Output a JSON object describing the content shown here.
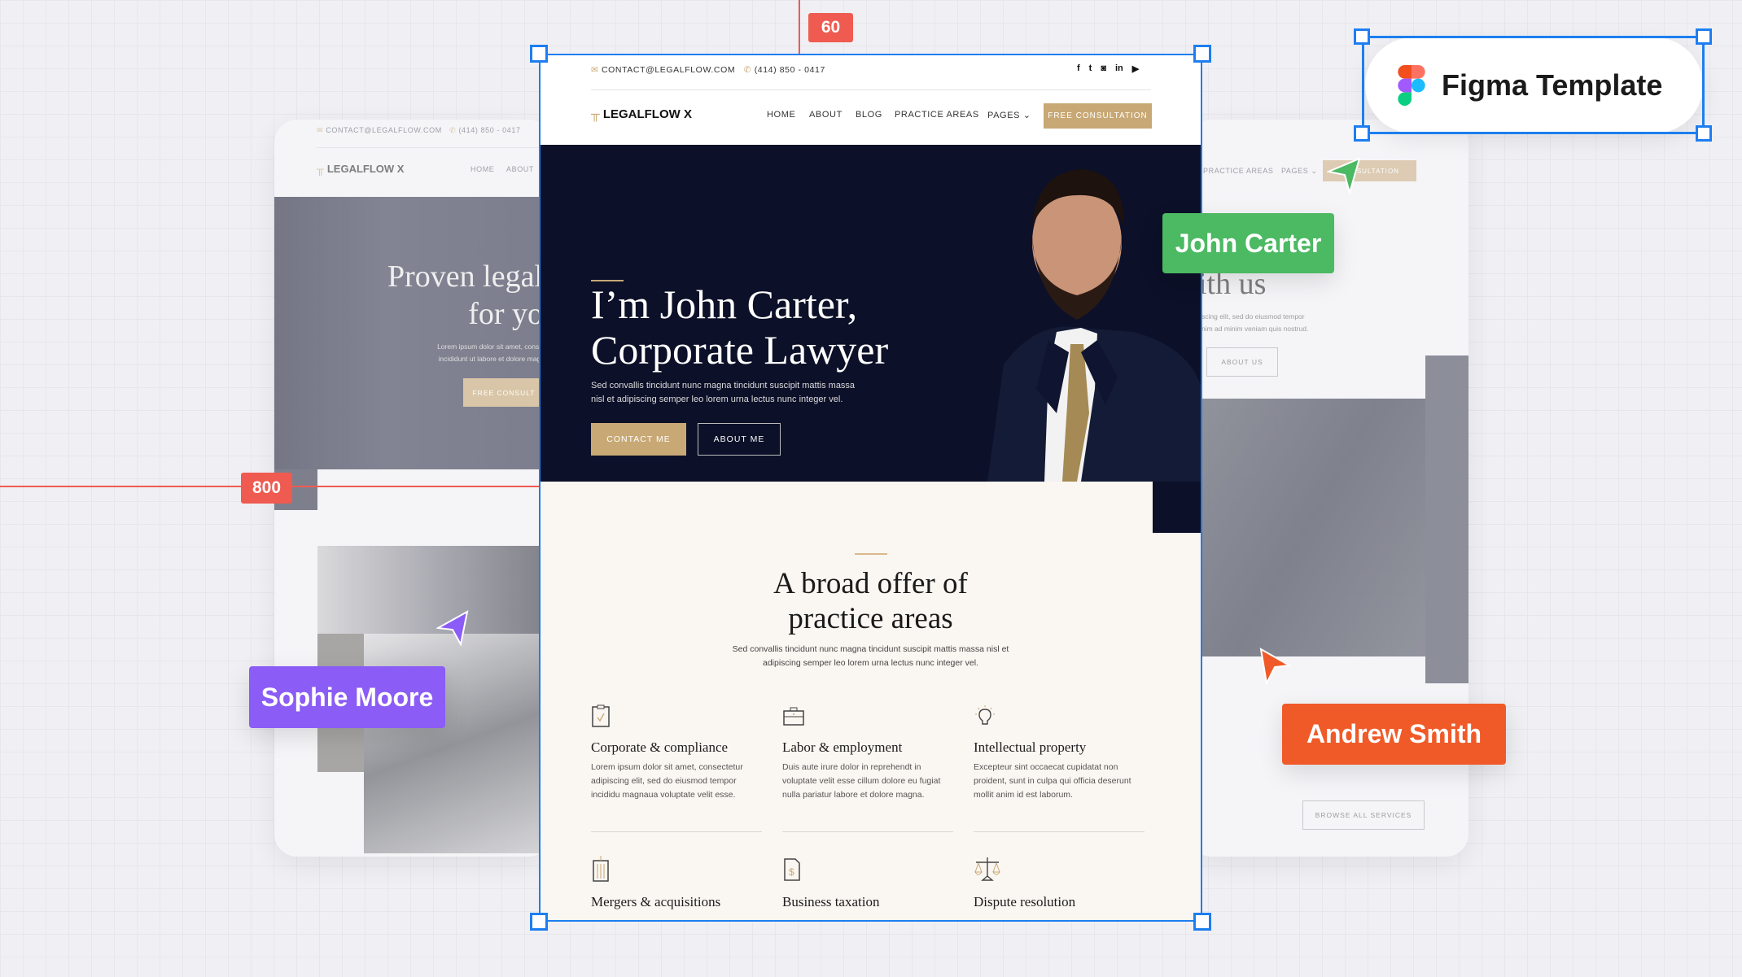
{
  "colors": {
    "accent_gold": "#c8a874",
    "hero_navy": "#0c1028",
    "cream": "#faf6f1",
    "selection_blue": "#1e7ef0",
    "measure_red": "#ef5b50",
    "john": "#4cb963",
    "sophie": "#8b5cf6",
    "andrew": "#f05a28"
  },
  "measure": {
    "top": "60",
    "left": "800"
  },
  "badge": {
    "label": "Figma Template",
    "icon": "figma-logo-icon"
  },
  "collaborators": [
    {
      "name": "John Carter"
    },
    {
      "name": "Sophie Moore"
    },
    {
      "name": "Andrew Smith"
    }
  ],
  "topbar": {
    "email": "CONTACT@LEGALFLOW.COM",
    "phone": "(414) 850 - 0417",
    "social": [
      "facebook-icon",
      "twitter-icon",
      "instagram-icon",
      "linkedin-icon",
      "youtube-icon"
    ]
  },
  "nav": {
    "logo": "LEGALFLOW X",
    "items": [
      "HOME",
      "ABOUT",
      "BLOG",
      "PRACTICE AREAS",
      "PAGES"
    ],
    "cta": "FREE CONSULTATION"
  },
  "hero": {
    "title_line1": "I’m John Carter,",
    "title_line2": "Corporate Lawyer",
    "text_line1": "Sed convallis tincidunt nunc magna tincidunt suscipit mattis massa",
    "text_line2": "nisl et adipiscing semper leo lorem urna lectus nunc integer vel.",
    "primary": "CONTACT ME",
    "secondary": "ABOUT ME"
  },
  "practice": {
    "title_line1": "A broad offer of",
    "title_line2": "practice areas",
    "text_line1": "Sed convallis tincidunt nunc magna tincidunt suscipit mattis massa nisl et",
    "text_line2": "adipiscing semper leo lorem urna lectus nunc integer vel.",
    "items": [
      {
        "icon": "clipboard-check-icon",
        "title": "Corporate & compliance",
        "text": "Lorem ipsum dolor sit amet, consectetur adipiscing elit, sed do eiusmod tempor incididu magnaua voluptate velit esse."
      },
      {
        "icon": "briefcase-icon",
        "title": "Labor & employment",
        "text": "Duis aute irure dolor in reprehendt in voluptate velit esse cillum dolore eu fugiat nulla pariatur labore et dolore magna."
      },
      {
        "icon": "lightbulb-icon",
        "title": "Intellectual property",
        "text": "Excepteur sint occaecat cupidatat non proident, sunt in culpa qui officia deserunt mollit anim id est laborum."
      },
      {
        "icon": "building-icon",
        "title": "Mergers & acquisitions"
      },
      {
        "icon": "tax-document-icon",
        "title": "Business taxation"
      },
      {
        "icon": "scales-icon",
        "title": "Dispute resolution"
      }
    ]
  },
  "left_card": {
    "email": "CONTACT@LEGALFLOW.COM",
    "phone": "(414) 850 - 0417",
    "logo": "LEGALFLOW X",
    "nav": [
      "HOME",
      "ABOUT"
    ],
    "title_line1": "Proven legal",
    "title_line2": "for yo",
    "text_line1": "Lorem ipsum dolor sit amet, conse",
    "text_line2": "incididunt ut labore et dolore magr",
    "cta": "FREE CONSULT"
  },
  "right_card": {
    "nav": [
      "PRACTICE AREAS",
      "PAGES"
    ],
    "cta": "CONSULTATION",
    "title": "ith us",
    "text_line1": "scing elit, sed do eiusmod tempor",
    "text_line2": "nim ad minim veniam quis nostrud.",
    "button": "ABOUT US",
    "browse": "BROWSE ALL SERVICES"
  }
}
